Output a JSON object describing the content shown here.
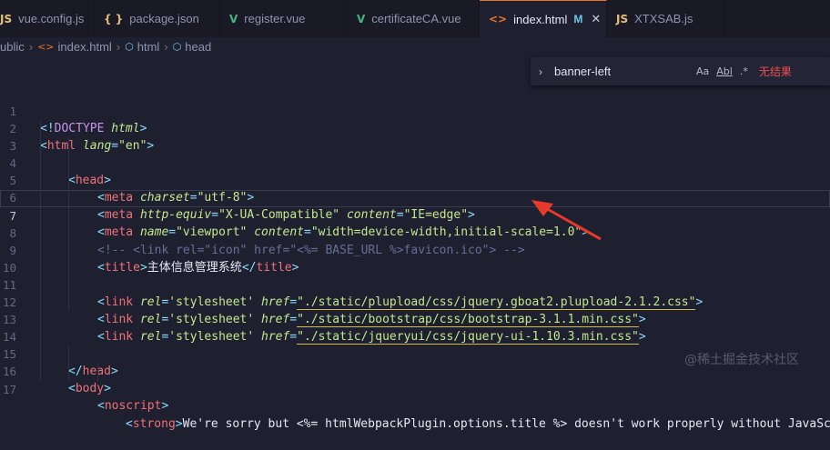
{
  "tabs": [
    {
      "label": "vue.config.js",
      "icon": "JS",
      "icon_color": "#e5c07b"
    },
    {
      "label": "package.json",
      "icon": "{ }",
      "icon_color": "#e5c07b"
    },
    {
      "label": "register.vue",
      "icon": "V",
      "icon_color": "#41b883"
    },
    {
      "label": "certificateCA.vue",
      "icon": "V",
      "icon_color": "#41b883"
    },
    {
      "label": "index.html",
      "icon": "<>",
      "icon_color": "#e8742c",
      "active": true,
      "modified": "M",
      "close": "✕"
    },
    {
      "label": "XTXSAB.js",
      "icon": "JS",
      "icon_color": "#e5c07b"
    }
  ],
  "breadcrumb": [
    "ublic",
    "index.html",
    "html",
    "head"
  ],
  "find": {
    "value": "banner-left",
    "case_label": "Aa",
    "word_label": "Abl",
    "regex_label": ".*",
    "status": "无结果"
  },
  "line_numbers": [
    "1",
    "2",
    "3",
    "4",
    "5",
    "6",
    "7",
    "8",
    "9",
    "10",
    "11",
    "12",
    "13",
    "14",
    "15",
    "16",
    "17"
  ],
  "code": {
    "l1": {
      "p1": "<!",
      "t": "DOCTYPE ",
      "a": "html",
      "p2": ">"
    },
    "l2": {
      "p1": "<",
      "t": "html ",
      "a": "lang",
      "eq": "=",
      "s": "\"en\"",
      "p2": ">"
    },
    "l3": {
      "p1": "<",
      "t": "head",
      "p2": ">"
    },
    "l4": {
      "p1": "<",
      "t": "meta ",
      "a": "charset",
      "eq": "=",
      "s": "\"utf-8\"",
      "p2": ">"
    },
    "l5": {
      "p1": "<",
      "t": "meta ",
      "a1": "http-equiv",
      "eq1": "=",
      "s1": "\"X-UA-Compatible\" ",
      "a2": "content",
      "eq2": "=",
      "s2": "\"IE=edge\"",
      "p2": ">"
    },
    "l6": {
      "p1": "<",
      "t": "meta ",
      "a1": "name",
      "eq1": "=",
      "s1": "\"viewport\" ",
      "a2": "content",
      "eq2": "=",
      "s2": "\"width=device-width,initial-scale=1.0\"",
      "p2": ">"
    },
    "l7": {
      "comment": "<!-- <link rel=\"icon\" href=\"<%= BASE_URL %>favicon.ico\"> -->"
    },
    "l8": {
      "p1": "<",
      "t": "title",
      "p2": ">",
      "text": "主体信息管理系统",
      "p3": "</",
      "t2": "title",
      "p4": ">"
    },
    "l10": {
      "p1": "<",
      "t": "link ",
      "a1": "rel",
      "eq1": "=",
      "s1": "'stylesheet' ",
      "a2": "href",
      "eq2": "=",
      "s2": "\"./static/plupload/css/jquery.gboat2.plupload-2.1.2.css\"",
      "p2": ">"
    },
    "l11": {
      "p1": "<",
      "t": "link ",
      "a1": "rel",
      "eq1": "=",
      "s1": "'stylesheet' ",
      "a2": "href",
      "eq2": "=",
      "s2": "\"./static/bootstrap/css/bootstrap-3.1.1.min.css\"",
      "p2": ">"
    },
    "l12": {
      "p1": "<",
      "t": "link ",
      "a1": "rel",
      "eq1": "=",
      "s1": "'stylesheet' ",
      "a2": "href",
      "eq2": "=",
      "s2": "\"./static/jqueryui/css/jquery-ui-1.10.3.min.css\"",
      "p2": ">"
    },
    "l14": {
      "p1": "</",
      "t": "head",
      "p2": ">"
    },
    "l15": {
      "p1": "<",
      "t": "body",
      "p2": ">"
    },
    "l16": {
      "p1": "<",
      "t": "noscript",
      "p2": ">"
    },
    "l17": {
      "p1": "<",
      "t": "strong",
      "p2": ">",
      "text": "We're sorry but ",
      "tpl": "<%= htmlWebpackPlugin.options.title %>",
      "rest": " doesn't work properly without JavaScri"
    }
  },
  "watermark": "@稀土掘金技术社区",
  "colors": {
    "accent": "#e8742c",
    "arrow": "#e8392a",
    "error": "#f14c4c"
  }
}
